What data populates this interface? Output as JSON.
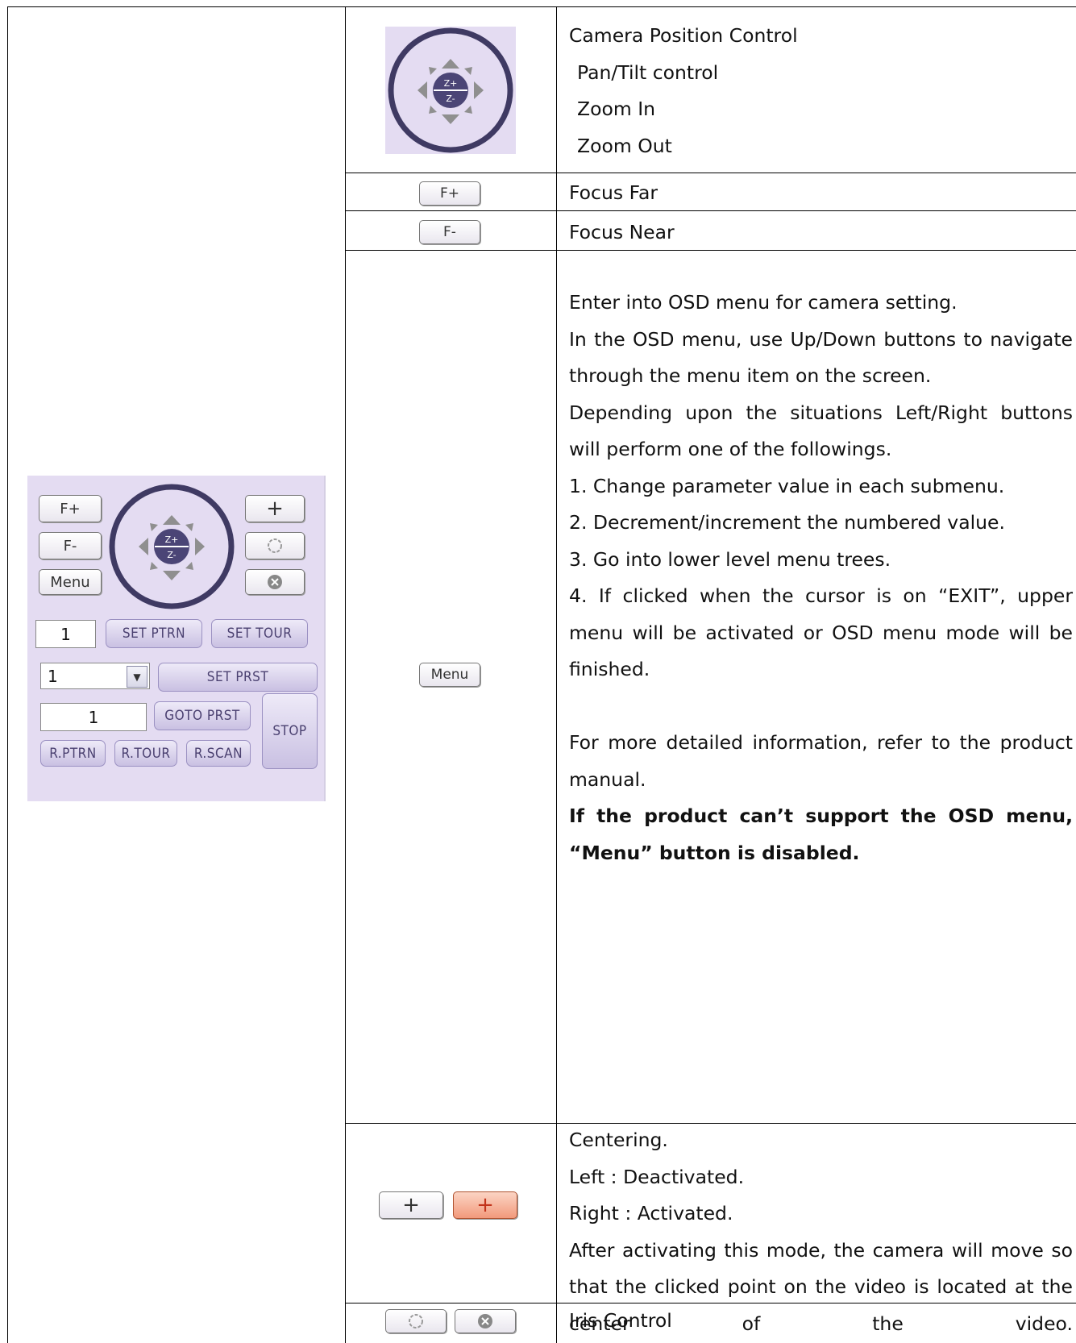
{
  "panel": {
    "focus_far": "F+",
    "focus_near": "F-",
    "menu": "Menu",
    "zoom_in": "Z+",
    "zoom_out": "Z-",
    "pattern_number": "1",
    "set_pattern": "SET PTRN",
    "set_tour": "SET TOUR",
    "preset_select": "1",
    "set_preset": "SET PRST",
    "goto_preset_number": "1",
    "goto_preset": "GOTO PRST",
    "stop": "STOP",
    "run_pattern": "R.PTRN",
    "run_tour": "R.TOUR",
    "run_scan": "R.SCAN",
    "center_symbol": "+"
  },
  "rows": {
    "camera": {
      "title": "Camera Position Control",
      "items": [
        "Pan/Tilt control",
        "Zoom In",
        "Zoom Out"
      ]
    },
    "focus_far": {
      "button": "F+",
      "desc": "Focus Far"
    },
    "focus_near": {
      "button": "F-",
      "desc": "Focus Near"
    },
    "menu": {
      "button": "Menu",
      "line1": "Enter into OSD menu for camera setting.",
      "para2": "In the OSD menu, use Up/Down buttons to navigate through the menu item on the screen.",
      "para3": "Depending upon the situations Left/Right buttons will perform one of the followings.",
      "item1": "1. Change parameter value in each submenu.",
      "item2": "2. Decrement/increment the numbered value.",
      "item3": "3. Go into lower level menu trees.",
      "item4": "4. If clicked when the cursor is on “EXIT”, upper menu will be activated or OSD menu mode will be finished.",
      "more": "For more detailed information, refer to the product manual.",
      "warning": "If the product can’t support the OSD menu, “Menu” button is disabled."
    },
    "centering": {
      "symbol": "+",
      "title": "Centering.",
      "left": "Left : Deactivated.",
      "right": "Right : Activated.",
      "para": "After activating this mode, the camera will move so that the clicked point on the video is located at the center of the video."
    },
    "iris": {
      "desc": "Iris Control"
    }
  }
}
